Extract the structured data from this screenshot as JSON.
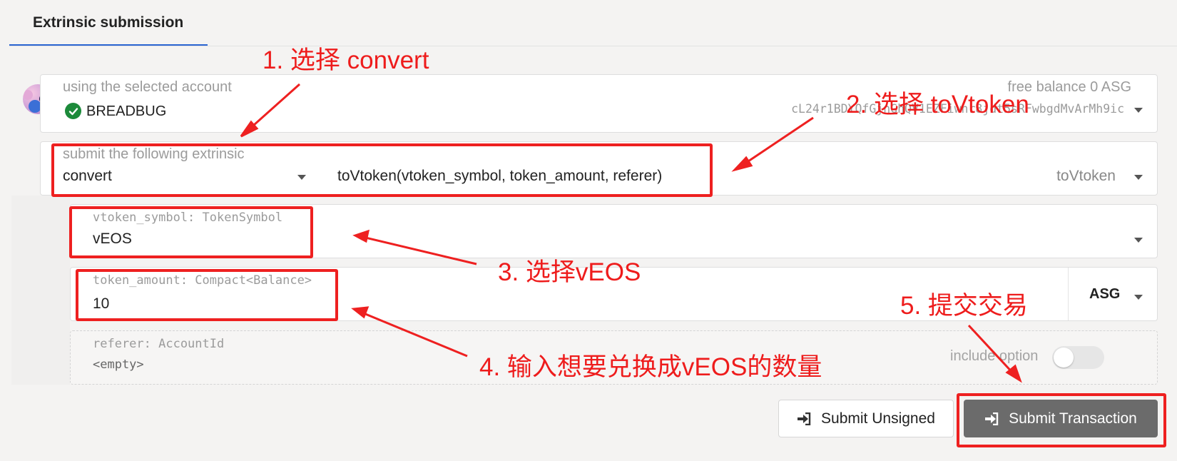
{
  "tabs": {
    "active_label": "Extrinsic submission"
  },
  "account": {
    "label": "using the selected account",
    "name": "BREADBUG",
    "balance_label": "free balance 0 ASG",
    "address": "cL24r1BDYQfGjnGhQV1EZFiwhr8jdt5sRFwbgdMvArMh9ic"
  },
  "extrinsic": {
    "label": "submit the following extrinsic",
    "module": "convert",
    "signature": "toVtoken(vtoken_symbol, token_amount, referer)",
    "method": "toVtoken"
  },
  "params": {
    "vtoken_symbol_label": "vtoken_symbol: TokenSymbol",
    "vtoken_symbol_value": "vEOS",
    "token_amount_label": "token_amount: Compact<Balance>",
    "token_amount_value": "10",
    "token_amount_unit": "ASG",
    "referer_label": "referer: AccountId",
    "referer_value": "<empty>",
    "include_option_label": "include option",
    "include_option_on": false
  },
  "buttons": {
    "submit_unsigned": "Submit Unsigned",
    "submit_transaction": "Submit Transaction"
  },
  "annotations": {
    "step1": "1. 选择 convert",
    "step2": "2. 选择 toVtoken",
    "step3": "3. 选择vEOS",
    "step4": "4. 输入想要兑换成vEOS的数量",
    "step5": "5. 提交交易"
  },
  "colors": {
    "annotation_red": "#ee2020",
    "tab_underline": "#2a64d1",
    "check_green": "#1c8a3a",
    "submit_button": "#6b6b6b"
  }
}
